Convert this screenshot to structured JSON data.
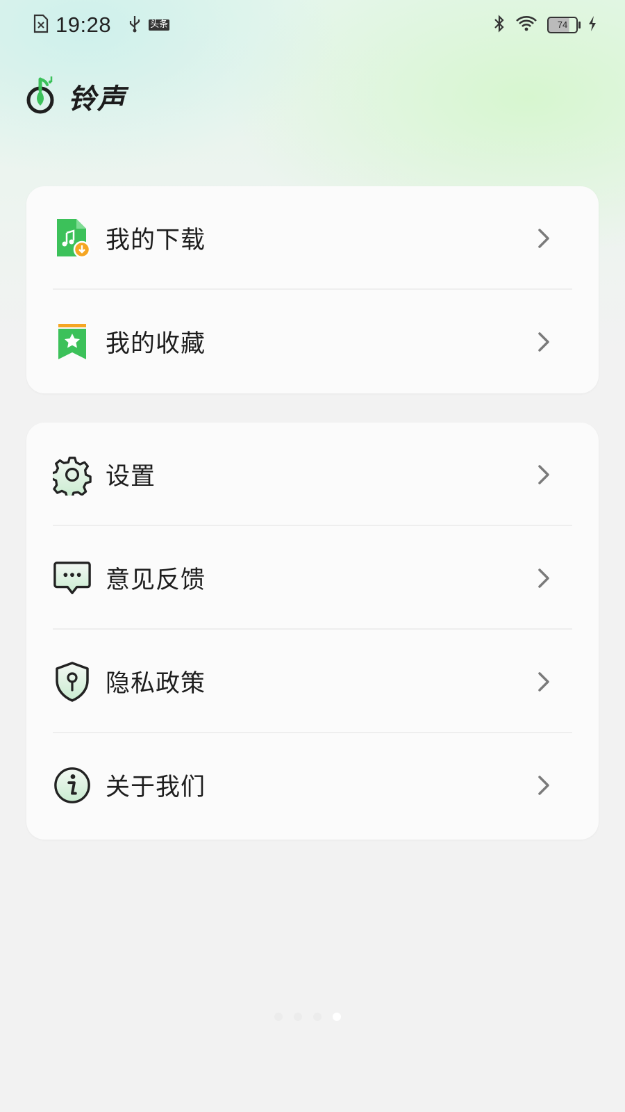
{
  "status_bar": {
    "time": "19:28",
    "notification_label": "头条",
    "battery_level": "74"
  },
  "app": {
    "title": "铃声",
    "accent": "#3cc15a"
  },
  "menu_groups": [
    {
      "items": [
        {
          "label": "我的下载",
          "icon": "download-file-icon"
        },
        {
          "label": "我的收藏",
          "icon": "bookmark-star-icon"
        }
      ]
    },
    {
      "items": [
        {
          "label": "设置",
          "icon": "gear-icon"
        },
        {
          "label": "意见反馈",
          "icon": "chat-bubble-icon"
        },
        {
          "label": "隐私政策",
          "icon": "shield-lock-icon"
        },
        {
          "label": "关于我们",
          "icon": "info-icon"
        }
      ]
    }
  ],
  "pager": {
    "count": 4,
    "active_index": 3
  }
}
